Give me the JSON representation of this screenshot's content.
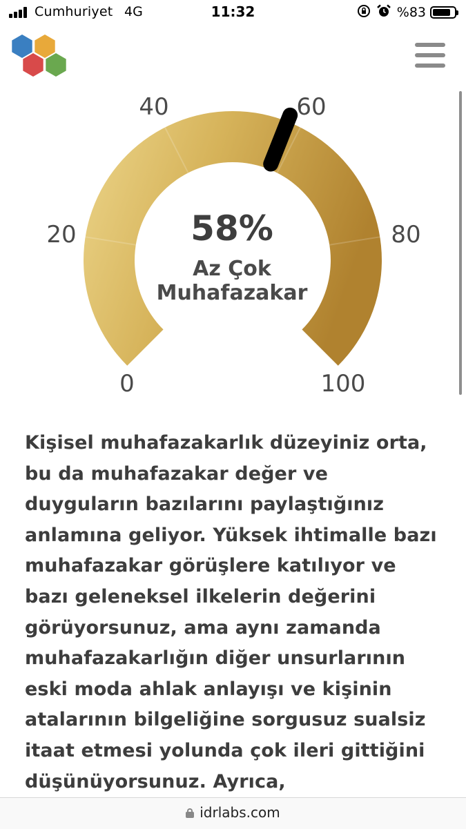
{
  "status_bar": {
    "carrier": "Cumhuriyet",
    "network": "4G",
    "time": "11:32",
    "battery_percent_label": "%83",
    "battery_level": 0.83,
    "icons": [
      "signal-bars-icon",
      "rotation-lock-icon",
      "alarm-clock-icon",
      "battery-icon"
    ]
  },
  "header": {
    "logo": "hexagon-logo-icon",
    "logo_colors": [
      "#3a7fc1",
      "#e8a93a",
      "#d84a4a",
      "#6aa84f"
    ],
    "menu_icon": "hamburger-menu-icon"
  },
  "gauge": {
    "value": 58,
    "value_text": "58%",
    "label_line1": "Az Çok",
    "label_line2": "Muhafazakar",
    "min": 0,
    "max": 100,
    "ticks": [
      "0",
      "20",
      "40",
      "60",
      "80",
      "100"
    ],
    "colors": {
      "light": "#ecd58a",
      "mid": "#d6b35a",
      "dark": "#b0822f",
      "needle": "#000000",
      "text": "#4a4a4a"
    }
  },
  "result": {
    "text": "Kişisel muhafazakarlık düzeyiniz orta, bu da muhafazakar değer ve duyguların bazılarını paylaştığınız anlamına geliyor. Yüksek ihtimalle bazı muhafazakar görüşlere katılıyor ve bazı geleneksel ilkelerin değerini görüyorsunuz, ama aynı zamanda muhafazakarlığın diğer unsurlarının eski moda ahlak anlayışı ve kişinin atalarının bilgeliğine sorgusuz sualsiz itaat etmesi yolunda çok ileri gittiğini düşünüyorsunuz. Ayrıca,"
  },
  "address_bar": {
    "url": "idrlabs.com",
    "icon": "lock-icon"
  }
}
